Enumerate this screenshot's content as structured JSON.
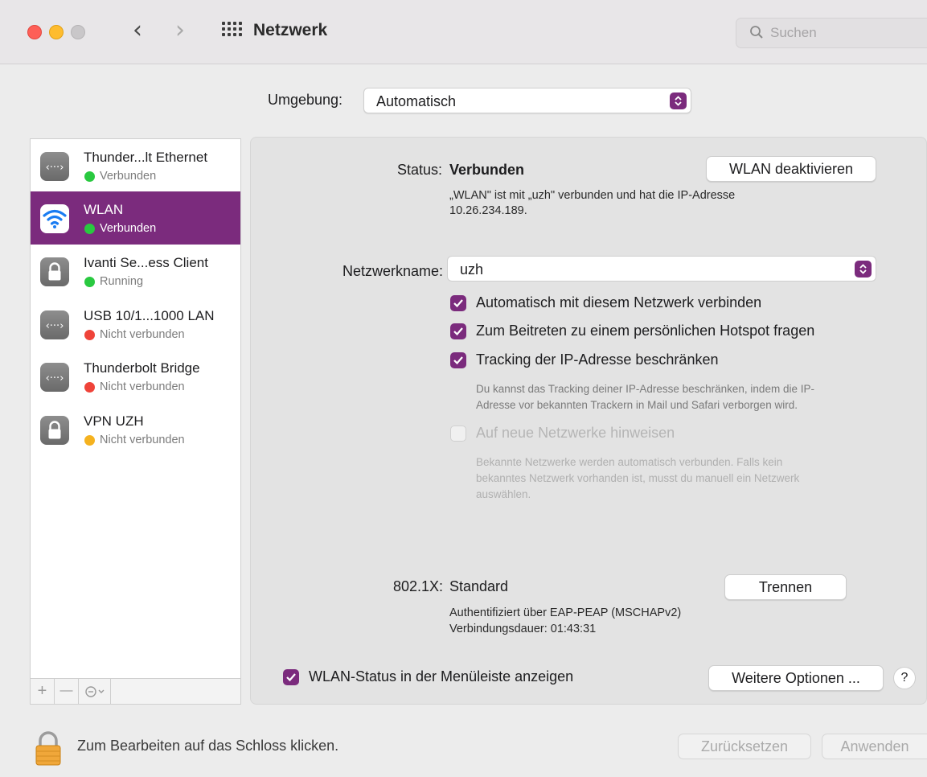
{
  "window": {
    "title": "Netzwerk"
  },
  "search": {
    "placeholder": "Suchen"
  },
  "location": {
    "label": "Umgebung:",
    "value": "Automatisch"
  },
  "services": [
    {
      "name": "Thunder...lt Ethernet",
      "status": "Verbunden",
      "dot": "green",
      "icon": "ethernet-icon"
    },
    {
      "name": "WLAN",
      "status": "Verbunden",
      "dot": "green",
      "icon": "wifi-icon"
    },
    {
      "name": "Ivanti Se...ess Client",
      "status": "Running",
      "dot": "green",
      "icon": "lock-icon"
    },
    {
      "name": "USB 10/1...1000 LAN",
      "status": "Nicht verbunden",
      "dot": "red",
      "icon": "ethernet-icon"
    },
    {
      "name": "Thunderbolt Bridge",
      "status": "Nicht verbunden",
      "dot": "red",
      "icon": "ethernet-icon"
    },
    {
      "name": "VPN UZH",
      "status": "Nicht verbunden",
      "dot": "yellow",
      "icon": "lock-icon"
    }
  ],
  "status": {
    "label": "Status:",
    "value": "Verbunden",
    "toggle_button": "WLAN deaktivieren",
    "description_line1": "„WLAN\" ist mit „uzh\" verbunden und hat die IP-Adresse",
    "description_line2": "10.26.234.189."
  },
  "network_name": {
    "label": "Netzwerkname:",
    "value": "uzh"
  },
  "options": {
    "auto_join": "Automatisch mit diesem Netzwerk verbinden",
    "hotspot": "Zum Beitreten zu einem persönlichen Hotspot fragen",
    "tracking": "Tracking der IP-Adresse beschränken",
    "tracking_hint_line1": "Du kannst das Tracking deiner IP-Adresse beschränken, indem die IP-",
    "tracking_hint_line2": "Adresse vor bekannten Trackern in Mail und Safari verborgen wird.",
    "notify": "Auf neue Netzwerke hinweisen",
    "notify_hint_line1": "Bekannte Netzwerke werden automatisch verbunden. Falls kein",
    "notify_hint_line2": "bekanntes Netzwerk vorhanden ist, musst du manuell ein Netzwerk",
    "notify_hint_line3": "auswählen."
  },
  "dot1x": {
    "label": "802.1X:",
    "value": "Standard",
    "button": "Trennen",
    "auth": "Authentifiziert über EAP-PEAP (MSCHAPv2)",
    "duration": "Verbindungsdauer: 01:43:31"
  },
  "menubar_checkbox": "WLAN-Status in der Menüleiste anzeigen",
  "more_options_button": "Weitere Optionen ...",
  "help_label": "?",
  "sidebar_controls": {
    "add": "+",
    "remove": "—"
  },
  "lock_text": "Zum Bearbeiten auf das Schloss klicken.",
  "footer": {
    "revert": "Zurücksetzen",
    "apply": "Anwenden"
  },
  "colors": {
    "accent": "#7b2b7d",
    "green": "#29c940",
    "red": "#ef4339",
    "yellow": "#f5b21f"
  }
}
